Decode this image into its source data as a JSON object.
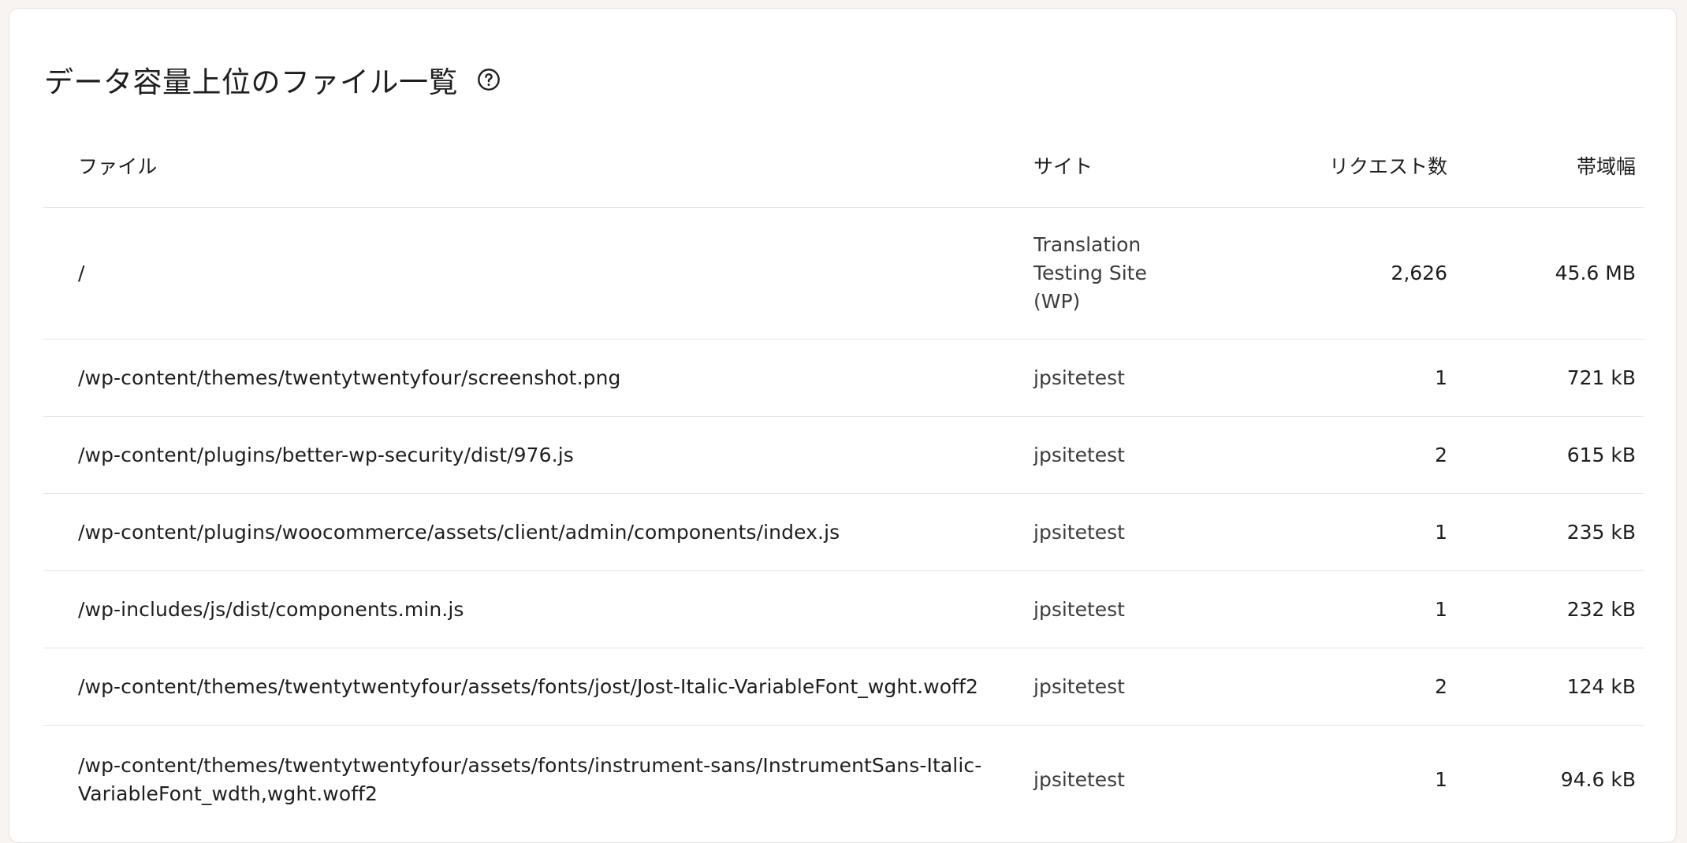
{
  "title": "データ容量上位のファイル一覧",
  "columns": {
    "file": "ファイル",
    "site": "サイト",
    "requests": "リクエスト数",
    "bandwidth": "帯域幅"
  },
  "rows": [
    {
      "file": "/",
      "site": "Translation Testing Site (WP)",
      "requests": "2,626",
      "bandwidth": "45.6 MB"
    },
    {
      "file": "/wp-content/themes/twentytwentyfour/screenshot.png",
      "site": "jpsitetest",
      "requests": "1",
      "bandwidth": "721 kB"
    },
    {
      "file": "/wp-content/plugins/better-wp-security/dist/976.js",
      "site": "jpsitetest",
      "requests": "2",
      "bandwidth": "615 kB"
    },
    {
      "file": "/wp-content/plugins/woocommerce/assets/client/admin/components/index.js",
      "site": "jpsitetest",
      "requests": "1",
      "bandwidth": "235 kB"
    },
    {
      "file": "/wp-includes/js/dist/components.min.js",
      "site": "jpsitetest",
      "requests": "1",
      "bandwidth": "232 kB"
    },
    {
      "file": "/wp-content/themes/twentytwentyfour/assets/fonts/jost/Jost-Italic-VariableFont_wght.woff2",
      "site": "jpsitetest",
      "requests": "2",
      "bandwidth": "124 kB"
    },
    {
      "file": "/wp-content/themes/twentytwentyfour/assets/fonts/instrument-sans/InstrumentSans-Italic-VariableFont_wdth,wght.woff2",
      "site": "jpsitetest",
      "requests": "1",
      "bandwidth": "94.6 kB"
    }
  ]
}
